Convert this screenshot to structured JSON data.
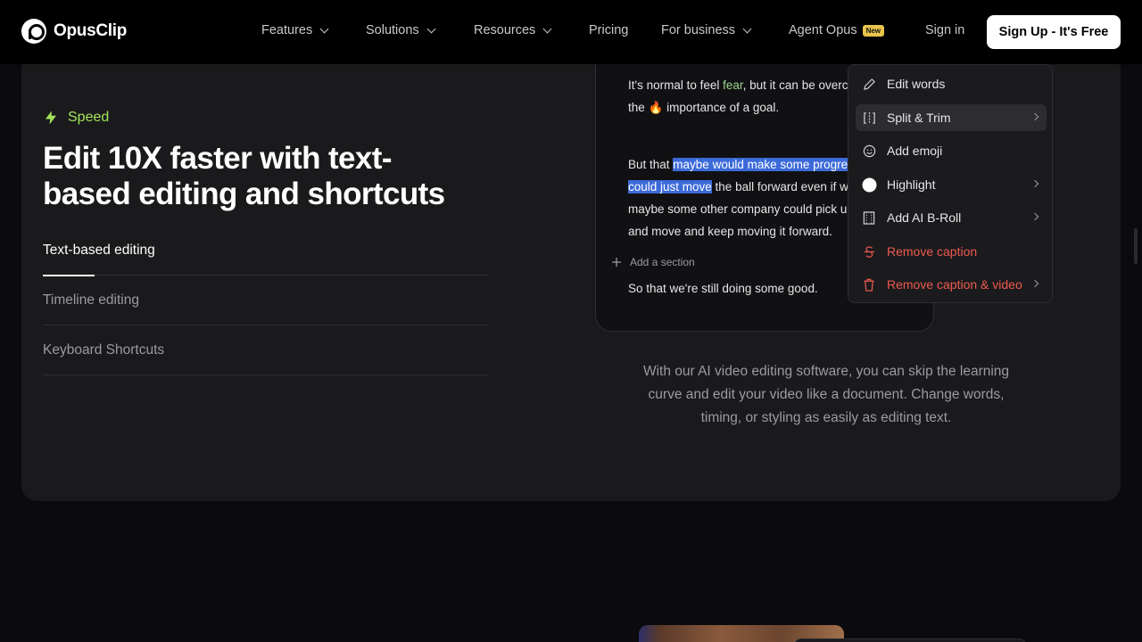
{
  "nav": {
    "brand": "OpusClip",
    "items": [
      {
        "label": "Features",
        "dropdown": true
      },
      {
        "label": "Solutions",
        "dropdown": true
      },
      {
        "label": "Resources",
        "dropdown": true
      },
      {
        "label": "Pricing",
        "dropdown": false
      },
      {
        "label": "For business",
        "dropdown": true
      },
      {
        "label": "Agent Opus",
        "dropdown": false
      }
    ],
    "new_badge": "New",
    "sign_in": "Sign in",
    "sign_up": "Sign Up - It's Free"
  },
  "feature": {
    "tag": "Speed",
    "headline_line1": "Edit 10X faster with text-",
    "headline_line2": "based editing and shortcuts",
    "tabs": [
      "Text-based editing",
      "Timeline editing",
      "Keyboard Shortcuts"
    ],
    "active_tab": "Text-based editing",
    "accent": "#a3e35a"
  },
  "editor": {
    "line1_a": "It's normal to feel ",
    "line1_green": "fear",
    "line1_b": ", but it can be overc",
    "line2_a": "the ",
    "line2_emoji": "🔥",
    "line2_b": " importance of a goal.",
    "line3_a": "But that ",
    "line3_hl": "maybe would make some progre",
    "line4_hl": "could just move",
    "line4_b": " the ball forward even if w",
    "line5": "maybe some other company could pick u",
    "line6": "and move and keep moving it forward.",
    "add_section": "Add a section",
    "line7": "So that we're still doing some good.",
    "highlight_color": "#3c6ad9"
  },
  "context_menu": {
    "items": [
      {
        "label": "Edit words",
        "icon": "pencil-icon",
        "submenu": false,
        "danger": false
      },
      {
        "label": "Split & Trim",
        "icon": "split-icon",
        "submenu": true,
        "danger": false
      },
      {
        "label": "Add emoji",
        "icon": "smiley-icon",
        "submenu": false,
        "danger": false
      },
      {
        "label": "Highlight",
        "icon": "circle-icon",
        "submenu": true,
        "danger": false
      },
      {
        "label": "Add AI B-Roll",
        "icon": "film-icon",
        "submenu": true,
        "danger": false
      },
      {
        "label": "Remove caption",
        "icon": "strikethrough-icon",
        "submenu": false,
        "danger": true
      },
      {
        "label": "Remove caption & video",
        "icon": "trash-icon",
        "submenu": true,
        "danger": true
      }
    ],
    "selected": "Split & Trim",
    "danger_color": "#ef5a4e"
  },
  "description": "With our AI video editing software, you can skip the learning curve and edit your video like a document. Change words, timing, or styling as easily as editing text."
}
